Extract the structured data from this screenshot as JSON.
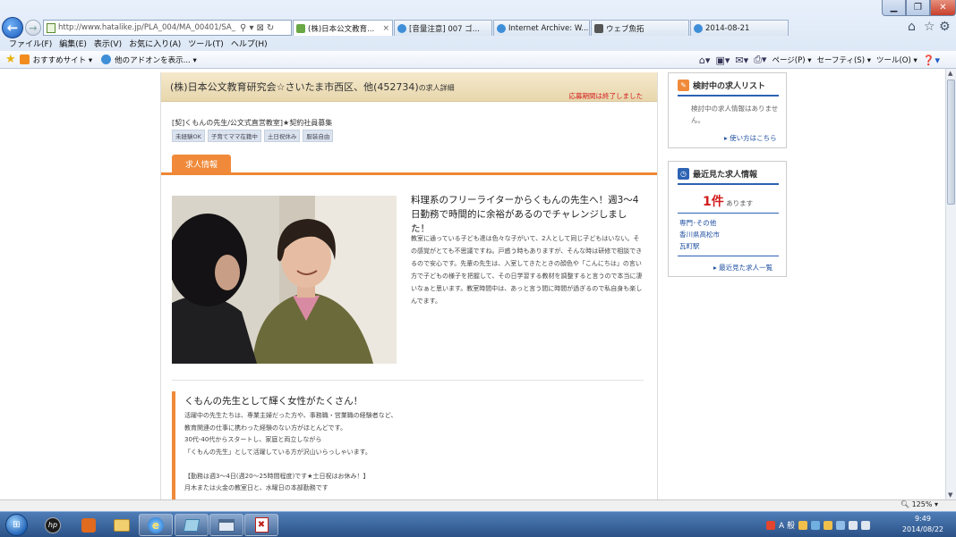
{
  "browser": {
    "url": "http://www.hatalike.jp/PLA_004/MA_00401/SA_",
    "address_tools": [
      "⚲ ▾",
      "⊠",
      "↻"
    ],
    "tabs": [
      {
        "label": "(株)日本公文教育...",
        "close": "×",
        "active": true
      },
      {
        "label": "[音量注意] 007 ゴ...",
        "active": false
      },
      {
        "label": "Internet Archive: W...",
        "active": false
      },
      {
        "label": "ウェブ魚拓",
        "active": false
      },
      {
        "label": "2014-08-21",
        "active": false
      }
    ],
    "menu": [
      "ファイル(F)",
      "編集(E)",
      "表示(V)",
      "お気に入り(A)",
      "ツール(T)",
      "ヘルプ(H)"
    ],
    "favorites": [
      "おすすめサイト ▾",
      "他のアドオンを表示... ▾"
    ],
    "command_bar": [
      "ページ(P) ▾",
      "セーフティ(S) ▾",
      "ツール(O) ▾"
    ],
    "zoom": "125%"
  },
  "job": {
    "company_title": "(株)日本公文教育研究会☆さいたま市西区、他(452734)",
    "title_suffix": "の求人詳細",
    "closed_notice": "応募期間は終了しました",
    "headline": "[契]くもんの先生/公文式直営教室]★契約社員募集",
    "tags": [
      "未経験OK",
      "子育てママ在籍中",
      "土日祝休み",
      "服装自由"
    ],
    "tab_label": "求人情報",
    "lead_title": "料理系のフリーライターからくもんの先生へ！週3〜4日勤務で時間的に余裕があるのでチャレンジしました！",
    "lead_body": "教室に通っている子ども達は色々な子がいて、2人として同じ子どもはいない。その感覚がとても不思議ですね。戸惑う時もありますが、そんな時は研修で相談できるので安心です。先輩の先生は、入室してきたときの顔色や「こんにちは」の言い方で子どもの様子を把握して、その日学習する教材を調整すると言うので本当に凄いなぁと思います。教室時間中は、あっと言う間に時間が過ぎるので私自身も楽しんでます。",
    "section2_title": "くもんの先生として輝く女性がたくさん！",
    "section2_lines": [
      "活躍中の先生たちは、専業主婦だった方や、事務職・営業職の経験者など、",
      "教育関連の仕事に携わった経験のない方がほとんどです。",
      "30代-40代からスタートし、家庭と両立しながら",
      "「くもんの先生」として活躍している方が沢山いらっしゃいます。",
      "",
      "【勤務は週3〜4日(週20〜25時間程度)です★土日祝はお休み！】",
      "月木または火金の教室日と、水曜日の本部勤務です"
    ]
  },
  "sidebar": {
    "review_title": "検討中の求人リスト",
    "review_body": "検討中の求人情報はありません。",
    "review_link": "▸ 使い方はこちら",
    "recent_title": "最近見た求人情報",
    "recent_count": "1件",
    "recent_count_suffix": "あります",
    "recent_items": [
      "専門･その他",
      "香川県高松市",
      "瓦町駅"
    ],
    "recent_link": "▸ 最近見た求人一覧"
  },
  "taskbar": {
    "start_label": "⊞",
    "app_icons": [
      "hp-icon",
      "app-icon",
      "explorer-icon",
      "ie-icon",
      "notepad-icon",
      "window-icon",
      "pdf-icon"
    ],
    "time": "9:49",
    "date": "2014/08/22",
    "ime_label": "A 般"
  },
  "colors": {
    "accent_orange": "#f08a3a",
    "title_band": "#f0e3c2",
    "link_blue": "#1f4fa0",
    "alert_red": "#d21c1c"
  }
}
